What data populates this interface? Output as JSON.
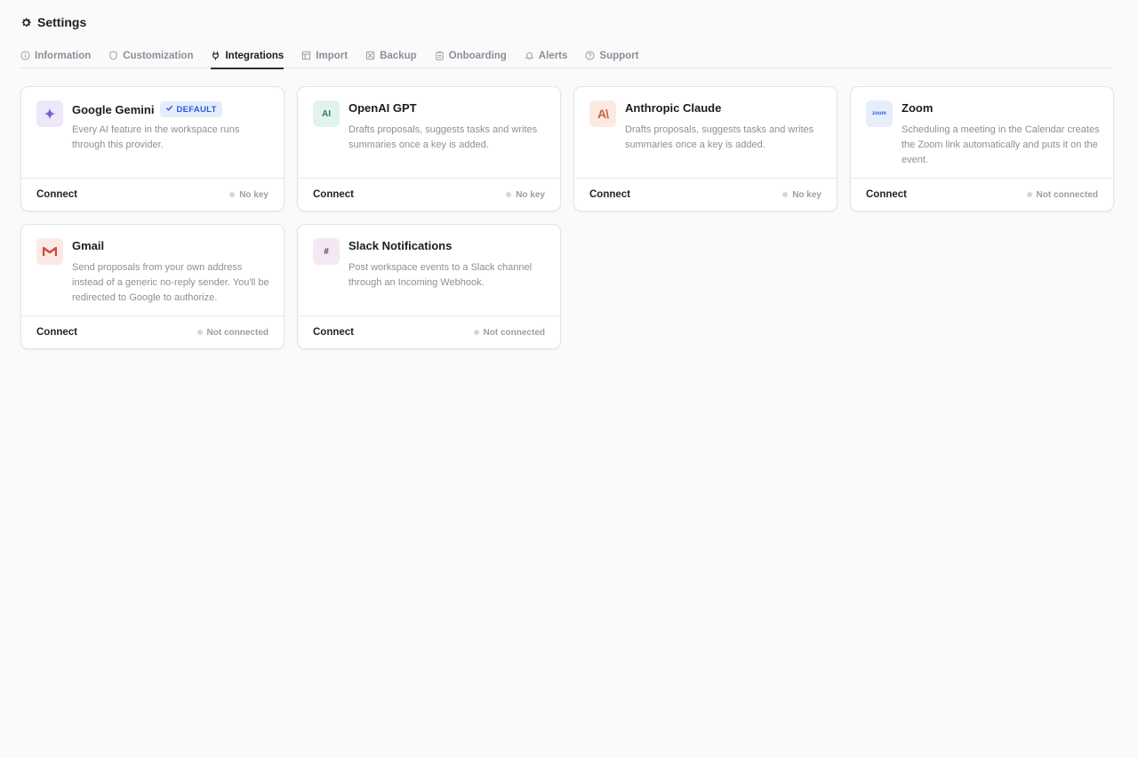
{
  "header": {
    "title": "Settings",
    "icon": "gear-icon"
  },
  "tabs": [
    {
      "label": "Information",
      "icon": "info-icon",
      "active": false
    },
    {
      "label": "Customization",
      "icon": "shield-icon",
      "active": false
    },
    {
      "label": "Integrations",
      "icon": "plug-icon",
      "active": true
    },
    {
      "label": "Import",
      "icon": "table-icon",
      "active": false
    },
    {
      "label": "Backup",
      "icon": "backup-icon",
      "active": false
    },
    {
      "label": "Onboarding",
      "icon": "clipboard-icon",
      "active": false
    },
    {
      "label": "Alerts",
      "icon": "bell-icon",
      "active": false
    },
    {
      "label": "Support",
      "icon": "help-icon",
      "active": false
    }
  ],
  "integrations": [
    {
      "name": "Google Gemini",
      "badge": "DEFAULT",
      "logo_text": "",
      "logo_icon": "gemini-sparkle-icon",
      "logo_bg": "#ece8f8",
      "logo_color": "#7b5fc8",
      "description": "Every AI feature in the workspace runs through this provider.",
      "connect_label": "Connect",
      "status": "No key"
    },
    {
      "name": "OpenAI GPT",
      "badge": "",
      "logo_text": "AI",
      "logo_icon": "openai-logo-icon",
      "logo_bg": "#e2f3ec",
      "logo_color": "#2a7d5c",
      "description": "Drafts proposals, suggests tasks and writes summaries once a key is added.",
      "connect_label": "Connect",
      "status": "No key"
    },
    {
      "name": "Anthropic Claude",
      "badge": "",
      "logo_text": "A\\",
      "logo_icon": "anthropic-logo-icon",
      "logo_bg": "#fbe9e2",
      "logo_color": "#c4633f",
      "description": "Drafts proposals, suggests tasks and writes summaries once a key is added.",
      "connect_label": "Connect",
      "status": "No key"
    },
    {
      "name": "Zoom",
      "badge": "",
      "logo_text": "zoom",
      "logo_icon": "zoom-logo-icon",
      "logo_bg": "#e6edfb",
      "logo_color": "#2d63d8",
      "description": "Scheduling a meeting in the Calendar creates the Zoom link automatically and puts it on the event.",
      "connect_label": "Connect",
      "status": "Not connected"
    },
    {
      "name": "Gmail",
      "badge": "",
      "logo_text": "",
      "logo_icon": "gmail-logo-icon",
      "logo_bg": "#fbe9e6",
      "logo_color": "#d6453a",
      "description": "Send proposals from your own address instead of a generic no-reply sender. You'll be redirected to Google to authorize.",
      "connect_label": "Connect",
      "status": "Not connected"
    },
    {
      "name": "Slack Notifications",
      "badge": "",
      "logo_text": "#",
      "logo_icon": "slack-hash-icon",
      "logo_bg": "#f4e8f3",
      "logo_color": "#6b2a66",
      "description": "Post workspace events to a Slack channel through an Incoming Webhook.",
      "connect_label": "Connect",
      "status": "Not connected"
    }
  ]
}
